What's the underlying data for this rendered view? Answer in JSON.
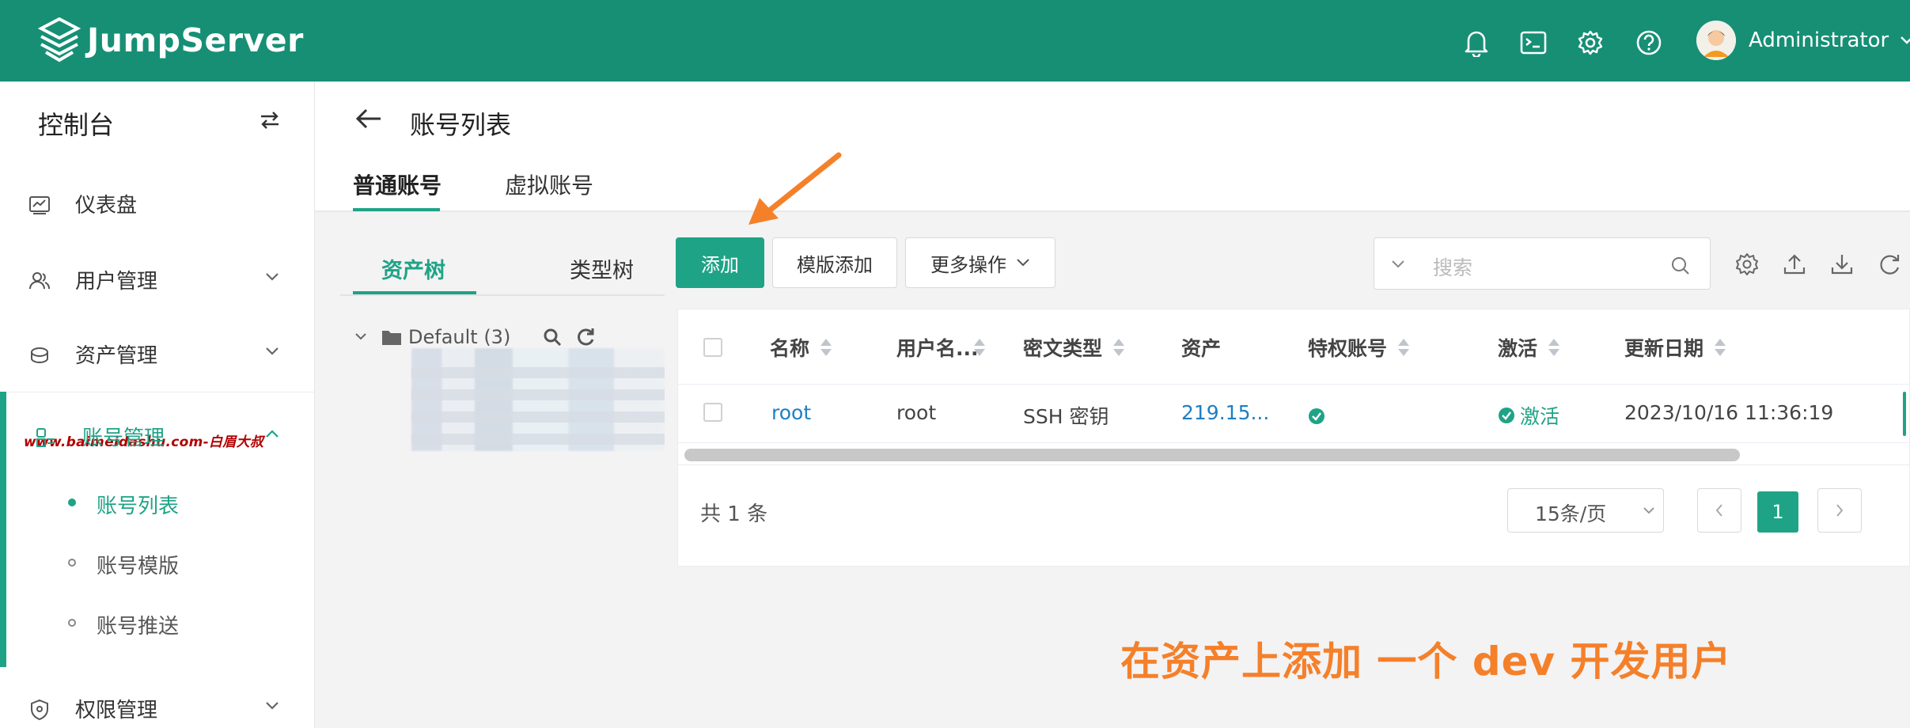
{
  "header": {
    "logo_text": "JumpServer",
    "user_name": "Administrator",
    "icons": [
      "bell-icon",
      "terminal-icon",
      "gear-icon",
      "help-icon"
    ],
    "accent": "#168f75"
  },
  "sidebar": {
    "console_label": "控制台",
    "items": [
      {
        "label": "仪表盘"
      },
      {
        "label": "用户管理"
      },
      {
        "label": "资产管理"
      },
      {
        "label": "账号管理"
      },
      {
        "label": "权限管理"
      }
    ],
    "sub_items": [
      {
        "label": "账号列表",
        "active": true
      },
      {
        "label": "账号模版",
        "active": false
      },
      {
        "label": "账号推送",
        "active": false
      }
    ],
    "watermark": "www.baimeidashu.com-白眉大叔"
  },
  "page": {
    "title": "账号列表",
    "tabs": [
      {
        "label": "普通账号",
        "active": true
      },
      {
        "label": "虚拟账号",
        "active": false
      }
    ]
  },
  "tree": {
    "tabs": [
      {
        "label": "资产树",
        "active": true
      },
      {
        "label": "类型树",
        "active": false
      }
    ],
    "root_node": "Default (3)"
  },
  "toolbar": {
    "add_label": "添加",
    "template_add_label": "模版添加",
    "more_label": "更多操作",
    "search_placeholder": "搜索"
  },
  "table": {
    "columns": [
      "名称",
      "用户名...",
      "密文类型",
      "资产",
      "特权账号",
      "激活",
      "更新日期"
    ],
    "rows": [
      {
        "name": "root",
        "username": "root",
        "secret_type": "SSH 密钥",
        "asset": "219.15...",
        "privileged": true,
        "active_label": "激活",
        "updated": "2023/10/16 11:36:19"
      }
    ],
    "total_label": "共 1 条",
    "page_size_label": "15条/页",
    "current_page": "1"
  },
  "annotation": {
    "caption": "在资产上添加 一个 dev 开发用户",
    "color": "#f5802a"
  }
}
